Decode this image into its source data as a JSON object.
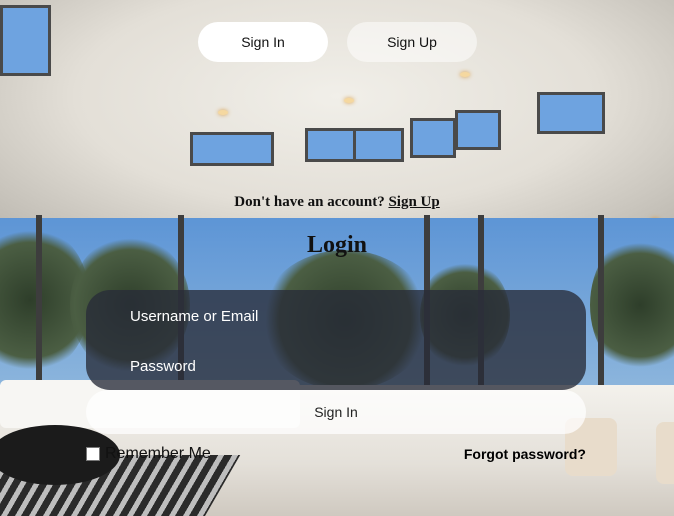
{
  "tabs": {
    "sign_in": "Sign In",
    "sign_up": "Sign Up"
  },
  "account_prompt": {
    "text": "Don't have an account?",
    "link": "Sign Up"
  },
  "form": {
    "title": "Login",
    "username_placeholder": "Username or Email",
    "password_placeholder": "Password",
    "submit_label": "Sign In",
    "remember_label": "Remember Me",
    "forgot_label": "Forgot password?"
  },
  "colors": {
    "field_background": "#282c38",
    "tab_active": "#ffffff"
  }
}
